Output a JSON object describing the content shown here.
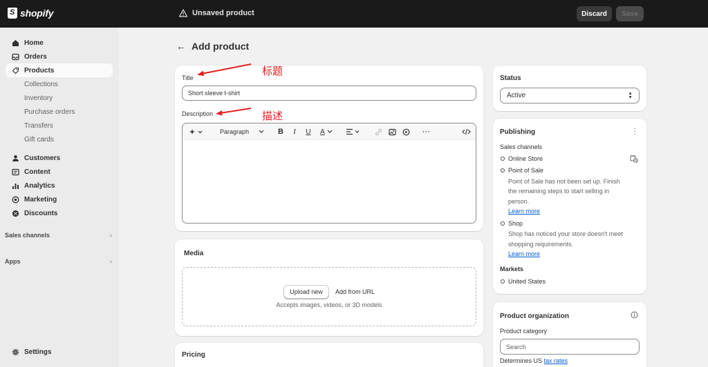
{
  "topbar": {
    "brand": "shopify",
    "status": "Unsaved product",
    "discard_label": "Discard",
    "save_label": "Save"
  },
  "sidebar": {
    "items": [
      {
        "label": "Home",
        "icon": "home-icon"
      },
      {
        "label": "Orders",
        "icon": "inbox-icon"
      },
      {
        "label": "Products",
        "icon": "tag-icon",
        "active": true
      },
      {
        "label": "Collections"
      },
      {
        "label": "Inventory"
      },
      {
        "label": "Purchase orders"
      },
      {
        "label": "Transfers"
      },
      {
        "label": "Gift cards"
      },
      {
        "label": "Customers",
        "icon": "person-icon"
      },
      {
        "label": "Content",
        "icon": "content-icon"
      },
      {
        "label": "Analytics",
        "icon": "bar-chart-icon"
      },
      {
        "label": "Marketing",
        "icon": "target-icon"
      },
      {
        "label": "Discounts",
        "icon": "discount-icon"
      }
    ],
    "sales_channels_label": "Sales channels",
    "apps_label": "Apps",
    "settings_label": "Settings"
  },
  "page": {
    "back_icon": "arrow-left-icon",
    "title": "Add product"
  },
  "product_form": {
    "title_label": "Title",
    "title_value": "Short sleeve t-shirt",
    "description_label": "Description",
    "paragraph_label": "Paragraph",
    "annotation_title": "标题",
    "annotation_description": "描述"
  },
  "media": {
    "heading": "Media",
    "upload_label": "Upload new",
    "add_url_label": "Add from URL",
    "hint": "Accepts images, videos, or 3D models"
  },
  "pricing": {
    "heading": "Pricing"
  },
  "status": {
    "heading": "Status",
    "selected": "Active"
  },
  "publishing": {
    "heading": "Publishing",
    "sales_channels_label": "Sales channels",
    "online_store": "Online Store",
    "pos": "Point of Sale",
    "pos_desc_1": "Point of Sale has not been set up. Finish",
    "pos_desc_2": "the remaining steps to start selling in",
    "pos_desc_3": "person.",
    "learn_more": "Learn more",
    "shop": "Shop",
    "shop_desc_1": "Shop has noticed your store doesn't meet",
    "shop_desc_2": "shopping requirements.",
    "markets_label": "Markets",
    "market_us": "United States"
  },
  "organization": {
    "heading": "Product organization",
    "category_label": "Product category",
    "search_placeholder": "Search",
    "determines_prefix": "Determines US",
    "tax_rates_link": "tax rates"
  }
}
